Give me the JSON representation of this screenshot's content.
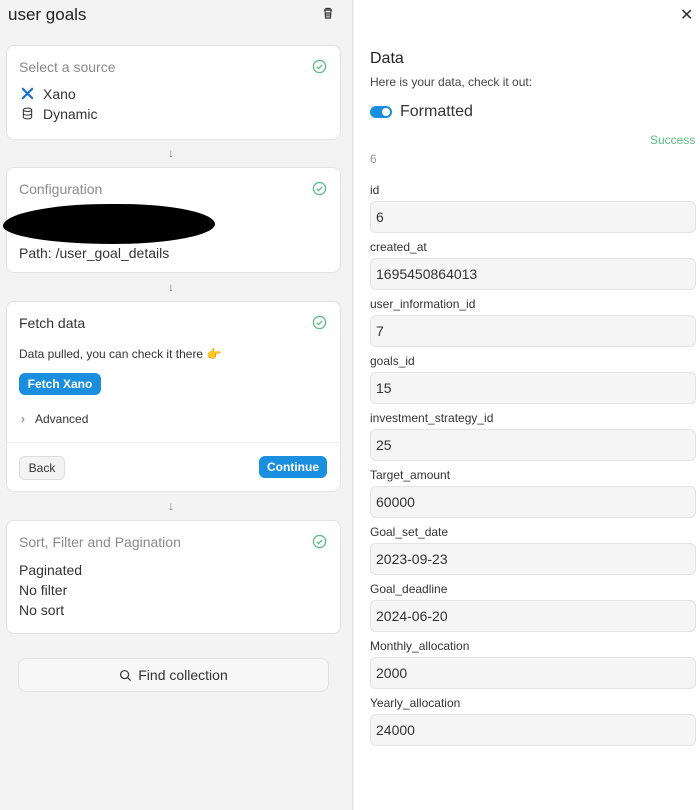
{
  "left": {
    "title": "user goals",
    "source_card": {
      "title": "Select a source",
      "items": [
        {
          "icon": "xano-icon",
          "label": "Xano"
        },
        {
          "icon": "database-icon",
          "label": "Dynamic"
        }
      ]
    },
    "config_card": {
      "title": "Configuration",
      "path": "Path: /user_goal_details"
    },
    "fetch_card": {
      "title": "Fetch data",
      "message": "Data pulled, you can check it there 👉",
      "fetch_button": "Fetch Xano",
      "advanced_label": "Advanced",
      "back_button": "Back",
      "continue_button": "Continue"
    },
    "sort_card": {
      "title": "Sort, Filter and Pagination",
      "lines": [
        "Paginated",
        "No filter",
        "No sort"
      ]
    },
    "find_collection": "Find collection",
    "accent_color": "#1a8fe0",
    "success_color": "#5cbd81"
  },
  "right": {
    "title": "Data",
    "subtitle": "Here is your data, check it out:",
    "toggle_label": "Formatted",
    "toggle_on": true,
    "status": "Success",
    "count": "6",
    "fields": [
      {
        "label": "id",
        "value": "6"
      },
      {
        "label": "created_at",
        "value": "1695450864013"
      },
      {
        "label": "user_information_id",
        "value": "7"
      },
      {
        "label": "goals_id",
        "value": "15"
      },
      {
        "label": "investment_strategy_id",
        "value": "25"
      },
      {
        "label": "Target_amount",
        "value": "60000"
      },
      {
        "label": "Goal_set_date",
        "value": "2023-09-23"
      },
      {
        "label": "Goal_deadline",
        "value": "2024-06-20"
      },
      {
        "label": "Monthly_allocation",
        "value": "2000"
      },
      {
        "label": "Yearly_allocation",
        "value": "24000"
      }
    ]
  }
}
